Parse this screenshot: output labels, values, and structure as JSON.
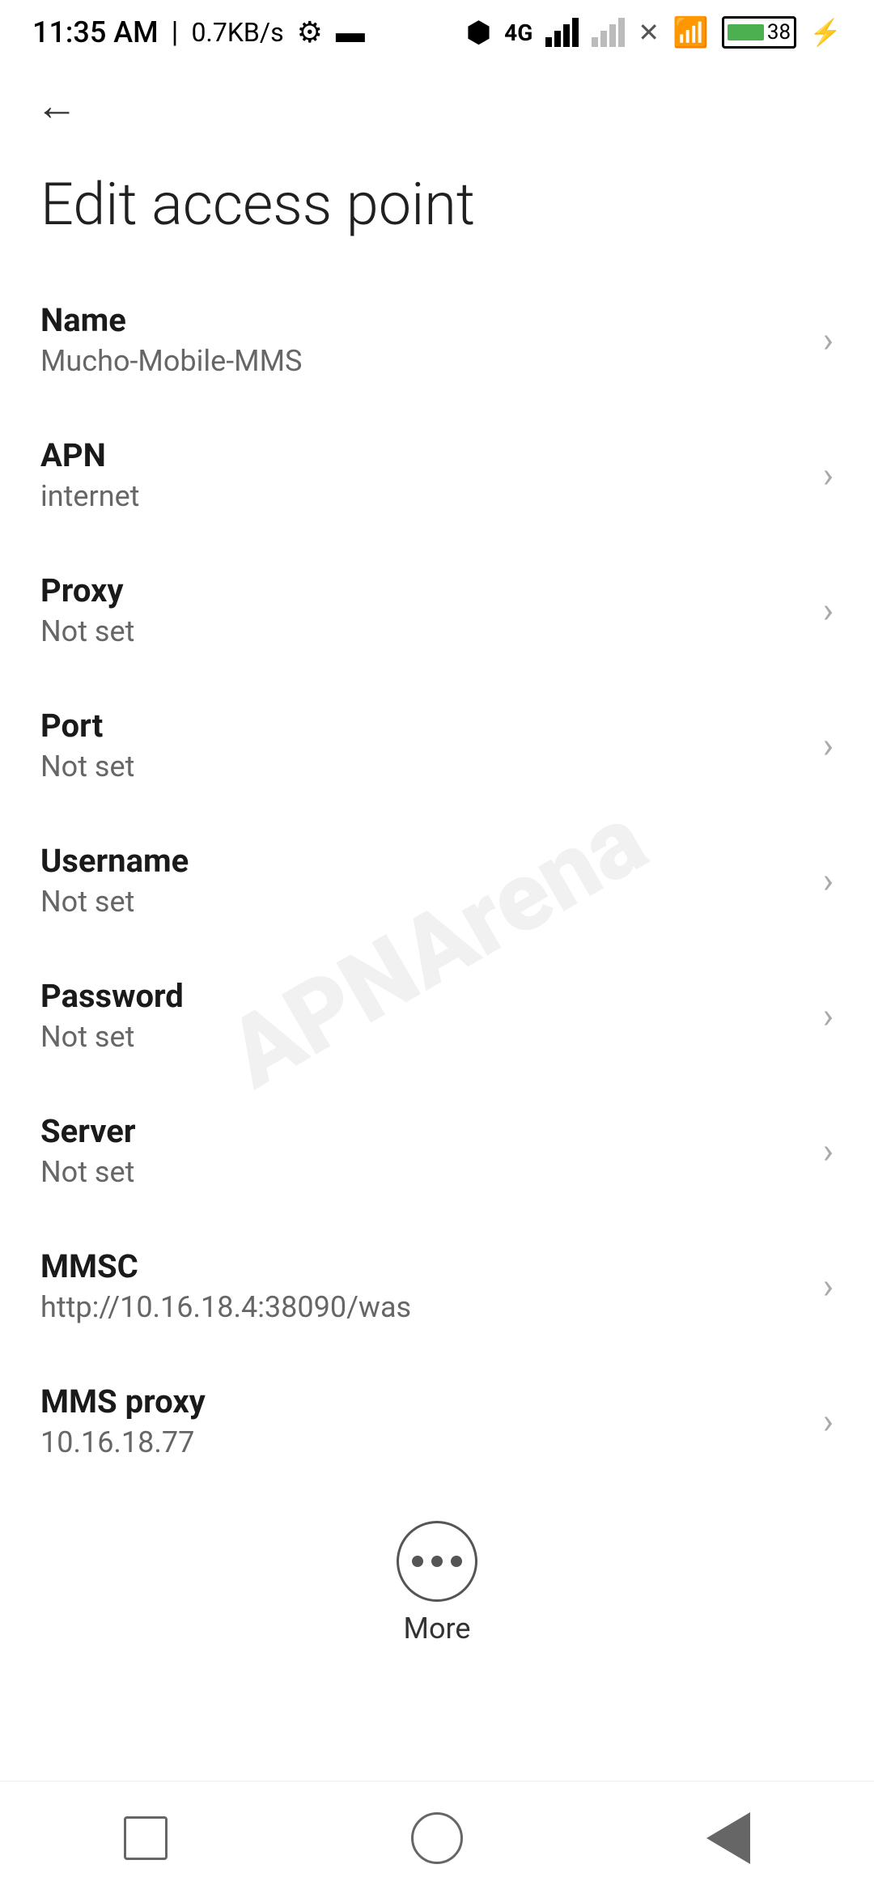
{
  "statusBar": {
    "time": "11:35 AM",
    "separator": "|",
    "speed": "0.7KB/s",
    "batteryPercent": "38"
  },
  "toolbar": {
    "backLabel": "←"
  },
  "pageTitle": "Edit access point",
  "settings": {
    "items": [
      {
        "label": "Name",
        "value": "Mucho-Mobile-MMS"
      },
      {
        "label": "APN",
        "value": "internet"
      },
      {
        "label": "Proxy",
        "value": "Not set"
      },
      {
        "label": "Port",
        "value": "Not set"
      },
      {
        "label": "Username",
        "value": "Not set"
      },
      {
        "label": "Password",
        "value": "Not set"
      },
      {
        "label": "Server",
        "value": "Not set"
      },
      {
        "label": "MMSC",
        "value": "http://10.16.18.4:38090/was"
      },
      {
        "label": "MMS proxy",
        "value": "10.16.18.77"
      }
    ]
  },
  "more": {
    "label": "More"
  },
  "watermark": "APNArena",
  "navBar": {
    "square": "",
    "circle": "",
    "triangle": ""
  }
}
